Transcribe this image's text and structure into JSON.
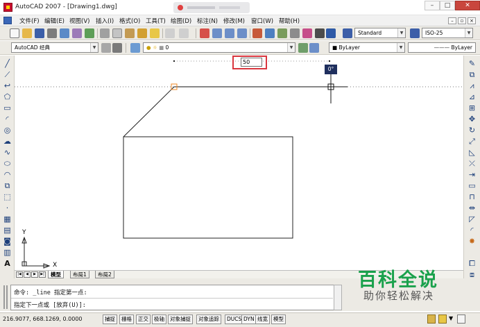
{
  "window": {
    "title": "AutoCAD 2007 - [Drawing1.dwg]",
    "minimize": "–",
    "maximize": "□",
    "close": "✕"
  },
  "menu": {
    "items": [
      "文件(F)",
      "编辑(E)",
      "视图(V)",
      "插入(I)",
      "格式(O)",
      "工具(T)",
      "绘图(D)",
      "标注(N)",
      "修改(M)",
      "窗口(W)",
      "帮助(H)"
    ],
    "doc_minimize": "–",
    "doc_restore": "▫",
    "doc_close": "×"
  },
  "toolbar": {
    "text_style": "Standard",
    "dim_style": "ISO-25",
    "workspace": "AutoCAD 经典",
    "layer": "0",
    "color": "ByLayer",
    "linetype": "ByLayer",
    "lineweight": "ByLayer"
  },
  "canvas": {
    "dynamic_input_value": "50",
    "angle_tooltip": "0°",
    "ucs_x_label": "X",
    "ucs_y_label": "Y"
  },
  "layout_tabs": [
    "模型",
    "布局1",
    "布局2"
  ],
  "command": {
    "line1": "命令: _line 指定第一点:",
    "line2": "指定下一点或 [放弃(U)]:"
  },
  "status": {
    "coordinates": "216.9077, 668.1269, 0.0000",
    "toggles": [
      "捕捉",
      "栅格",
      "正交",
      "极轴",
      "对象捕捉",
      "对象追踪",
      "DUCS",
      "DYN",
      "线宽",
      "模型"
    ]
  },
  "watermark": {
    "title": "百科全说",
    "subtitle": "助你轻松解决"
  },
  "colors": {
    "highlight_box": "#d9363e",
    "tooltip_bg": "#1f2f5e",
    "watermark_green": "#1aa14c",
    "snap_marker": "#f08a24"
  }
}
